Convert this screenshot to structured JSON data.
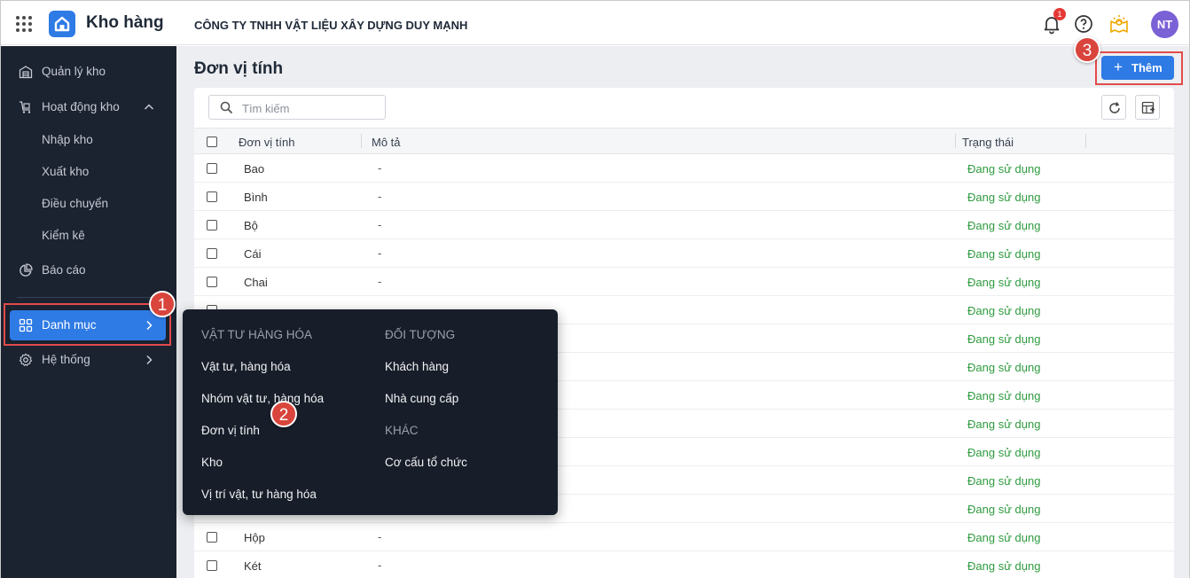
{
  "header": {
    "app_title": "Kho hàng",
    "company": "CÔNG TY TNHH VẬT LIỆU XÂY DỰNG DUY MẠNH",
    "notification_count": "1",
    "avatar_initials": "NT"
  },
  "sidebar": {
    "items": [
      {
        "label": "Quản lý kho"
      },
      {
        "label": "Hoạt động kho"
      },
      {
        "label": "Báo cáo"
      },
      {
        "label": "Danh mục"
      },
      {
        "label": "Hệ thống"
      }
    ],
    "sub_items": [
      "Nhập kho",
      "Xuất kho",
      "Điều chuyển",
      "Kiểm kê"
    ]
  },
  "page": {
    "title": "Đơn vị tính",
    "add_button": "Thêm",
    "search_placeholder": "Tìm kiếm"
  },
  "table": {
    "columns": [
      "Đơn vị tính",
      "Mô tả",
      "Trạng thái"
    ],
    "rows": [
      {
        "name": "Bao",
        "desc": "-",
        "status": "Đang sử dụng"
      },
      {
        "name": "Bình",
        "desc": "-",
        "status": "Đang sử dụng"
      },
      {
        "name": "Bộ",
        "desc": "-",
        "status": "Đang sử dụng"
      },
      {
        "name": "Cái",
        "desc": "-",
        "status": "Đang sử dụng"
      },
      {
        "name": "Chai",
        "desc": "-",
        "status": "Đang sử dụng"
      },
      {
        "name": "",
        "desc": "",
        "status": "Đang sử dụng"
      },
      {
        "name": "",
        "desc": "",
        "status": "Đang sử dụng"
      },
      {
        "name": "",
        "desc": "",
        "status": "Đang sử dụng"
      },
      {
        "name": "",
        "desc": "",
        "status": "Đang sử dụng"
      },
      {
        "name": "",
        "desc": "",
        "status": "Đang sử dụng"
      },
      {
        "name": "",
        "desc": "",
        "status": "Đang sử dụng"
      },
      {
        "name": "",
        "desc": "",
        "status": "Đang sử dụng"
      },
      {
        "name": "",
        "desc": "",
        "status": "Đang sử dụng"
      },
      {
        "name": "Hộp",
        "desc": "-",
        "status": "Đang sử dụng"
      },
      {
        "name": "Két",
        "desc": "-",
        "status": "Đang sử dụng"
      }
    ]
  },
  "menu": {
    "col1_header": "VẬT TƯ HÀNG HÓA",
    "col1_items": [
      "Vật tư, hàng hóa",
      "Nhóm vật tư, hàng hóa",
      "Đơn vị tính",
      "Kho",
      "Vị trí vật, tư hàng hóa"
    ],
    "col2_header": "ĐỐI TƯỢNG",
    "col2_items": [
      "Khách hàng",
      "Nhà cung cấp"
    ],
    "col3_header": "KHÁC",
    "col3_items": [
      "Cơ cấu tổ chức"
    ]
  },
  "annotations": {
    "step1": "1",
    "step2": "2",
    "step3": "3"
  }
}
